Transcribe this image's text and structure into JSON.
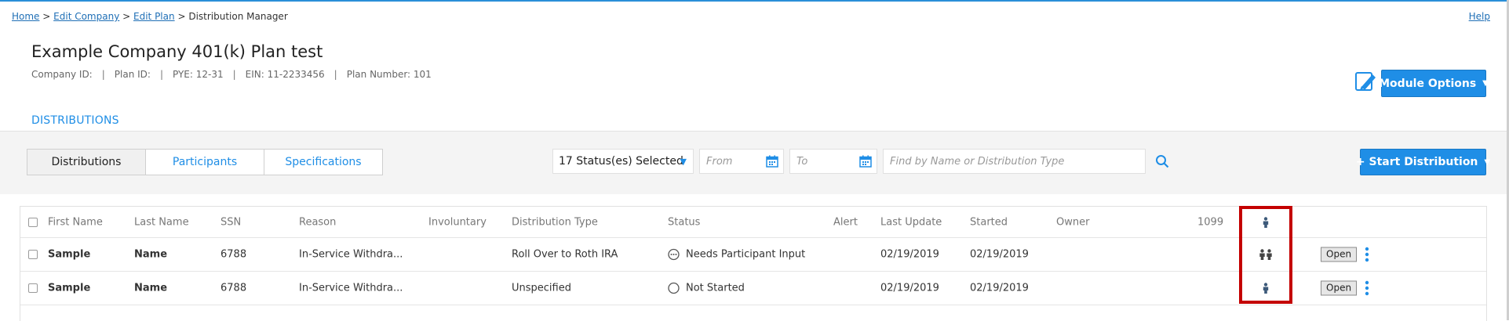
{
  "breadcrumb": {
    "home": "Home",
    "edit_company": "Edit Company",
    "edit_plan": "Edit Plan",
    "current": "Distribution Manager",
    "separator": ">"
  },
  "help": "Help",
  "header": {
    "title": "Example Company 401(k) Plan test",
    "meta": {
      "company_id": "Company ID:",
      "plan_id": "Plan ID:",
      "pye": "PYE: 12-31",
      "ein": "EIN: 11-2233456",
      "plan_number": "Plan Number: 101",
      "separator": "|"
    }
  },
  "module_options": "Module Options",
  "tabs": {
    "distributions": "DISTRIBUTIONS"
  },
  "segments": [
    "Distributions",
    "Participants",
    "Specifications"
  ],
  "filters": {
    "status": "17 Status(es) Selected",
    "from": "From",
    "to": "To",
    "search_placeholder": "Find by Name or Distribution Type"
  },
  "start_distribution": "+ Start Distribution",
  "table": {
    "columns": {
      "first_name": "First Name",
      "last_name": "Last Name",
      "ssn": "SSN",
      "reason": "Reason",
      "involuntary": "Involuntary",
      "distribution_type": "Distribution Type",
      "status": "Status",
      "alert": "Alert",
      "last_update": "Last Update",
      "started": "Started",
      "owner": "Owner",
      "form_1099": "1099"
    },
    "rows": [
      {
        "first_name": "Sample",
        "last_name": "Name",
        "ssn": "6788",
        "reason": "In-Service Withdra...",
        "distribution_type": "Roll Over to Roth IRA",
        "status": "Needs Participant Input",
        "status_icon": "ellipsis-circle-icon",
        "last_update": "02/19/2019",
        "started": "02/19/2019",
        "participant_icon": "two-people-icon",
        "action": "Open"
      },
      {
        "first_name": "Sample",
        "last_name": "Name",
        "ssn": "6788",
        "reason": "In-Service Withdra...",
        "distribution_type": "Unspecified",
        "status": "Not Started",
        "status_icon": "empty-circle-icon",
        "last_update": "02/19/2019",
        "started": "02/19/2019",
        "participant_icon": "person-icon",
        "action": "Open"
      }
    ]
  },
  "colors": {
    "accent": "#1f8ee6",
    "link": "#1f6fb6",
    "highlight": "#c40000",
    "person_icon": "#3d5a7a"
  }
}
